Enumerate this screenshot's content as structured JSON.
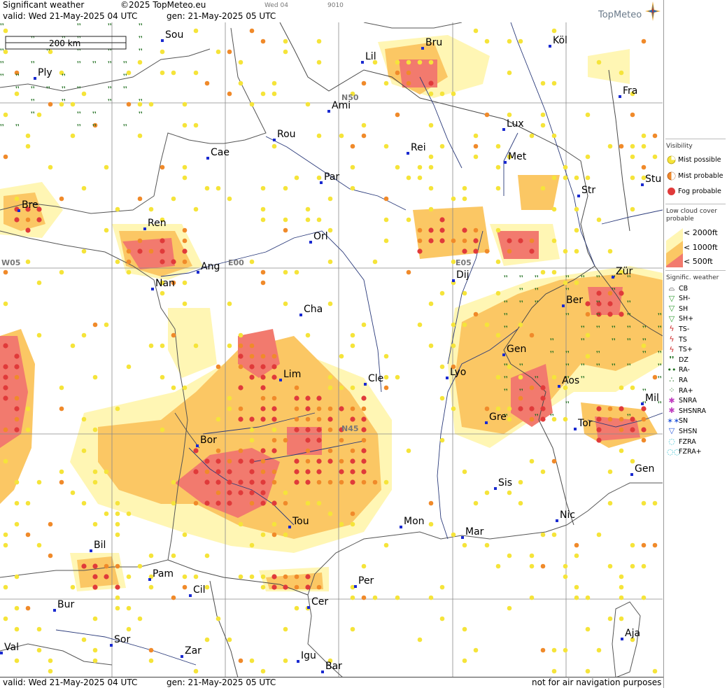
{
  "header": {
    "title": "Significant weather",
    "copyright": "©2025 TopMeteo.eu",
    "valid_line": "valid:  Wed  21-May-2025  04 UTC",
    "gen_line": "gen: 21-May-2025 05 UTC",
    "small_label_1": "Wed 04",
    "small_label_2": "9010",
    "logo_text": "TopMeteo"
  },
  "footer": {
    "valid_line": "valid:  Wed  21-May-2025  04 UTC",
    "gen_line": "gen: 21-May-2025 05 UTC",
    "disclaimer": "not for air navigation purposes"
  },
  "scale_label": "200 km",
  "grid_labels": {
    "n50": "N50",
    "n45": "N45",
    "w05": "W05",
    "e00": "E00",
    "e05": "E05"
  },
  "cities": [
    {
      "name": "Sou"
    },
    {
      "name": "Köl"
    },
    {
      "name": "Ply"
    },
    {
      "name": "Lil"
    },
    {
      "name": "Bru"
    },
    {
      "name": "Ami"
    },
    {
      "name": "Fra"
    },
    {
      "name": "Rou"
    },
    {
      "name": "Lux"
    },
    {
      "name": "Cae"
    },
    {
      "name": "Rei"
    },
    {
      "name": "Met"
    },
    {
      "name": "Par"
    },
    {
      "name": "Stu"
    },
    {
      "name": "Bre"
    },
    {
      "name": "Str"
    },
    {
      "name": "Ren"
    },
    {
      "name": "Orl"
    },
    {
      "name": "Ang"
    },
    {
      "name": "Dij"
    },
    {
      "name": "Zür"
    },
    {
      "name": "Nan"
    },
    {
      "name": "Ber"
    },
    {
      "name": "Cha"
    },
    {
      "name": "Gen"
    },
    {
      "name": "Lim"
    },
    {
      "name": "Cle"
    },
    {
      "name": "Lyo"
    },
    {
      "name": "Aos"
    },
    {
      "name": "Mil"
    },
    {
      "name": "Gre"
    },
    {
      "name": "Tor"
    },
    {
      "name": "Bor"
    },
    {
      "name": "Gen"
    },
    {
      "name": "Sis"
    },
    {
      "name": "Nic"
    },
    {
      "name": "Tou"
    },
    {
      "name": "Mon"
    },
    {
      "name": "Mar"
    },
    {
      "name": "Bil"
    },
    {
      "name": "Pam"
    },
    {
      "name": "Per"
    },
    {
      "name": "Cil"
    },
    {
      "name": "Bur"
    },
    {
      "name": "Cer"
    },
    {
      "name": "Sor"
    },
    {
      "name": "Val"
    },
    {
      "name": "Zar"
    },
    {
      "name": "Igu"
    },
    {
      "name": "Aja"
    },
    {
      "name": "Bar"
    }
  ],
  "legend": {
    "visibility_title": "Visibility",
    "mist_possible": "Mist possible",
    "mist_probable": "Mist probable",
    "fog_probable": "Fog probable",
    "lowcloud_title": "Low cloud cover probable",
    "lc_2000": "< 2000ft",
    "lc_1000": "< 1000ft",
    "lc_500": "<   500ft",
    "sigwx_title": "Signific. weather",
    "items": [
      {
        "label": "CB",
        "icon": "cb-icon",
        "glyph": "⌓",
        "color": "#333333"
      },
      {
        "label": "SH-",
        "icon": "shower-light-icon",
        "glyph": "▽",
        "color": "#2e9a2e"
      },
      {
        "label": "SH",
        "icon": "shower-icon",
        "glyph": "▽",
        "color": "#2e9a2e"
      },
      {
        "label": "SH+",
        "icon": "shower-heavy-icon",
        "glyph": "▽",
        "color": "#2e9a2e"
      },
      {
        "label": "TS-",
        "icon": "thunderstorm-light-icon",
        "glyph": "ϟ",
        "color": "#cc2a2a"
      },
      {
        "label": "TS",
        "icon": "thunderstorm-icon",
        "glyph": "ϟ",
        "color": "#cc2a2a"
      },
      {
        "label": "TS+",
        "icon": "thunderstorm-heavy-icon",
        "glyph": "ϟ",
        "color": "#cc2a2a"
      },
      {
        "label": "DZ",
        "icon": "drizzle-icon",
        "glyph": "❜❜",
        "color": "#1e6e1e"
      },
      {
        "label": "RA-",
        "icon": "rain-light-icon",
        "glyph": "••",
        "color": "#1e6e1e"
      },
      {
        "label": "RA",
        "icon": "rain-icon",
        "glyph": "∴",
        "color": "#1e6e1e"
      },
      {
        "label": "RA+",
        "icon": "rain-heavy-icon",
        "glyph": "⁘",
        "color": "#1e6e1e"
      },
      {
        "label": "SNRA",
        "icon": "snow-rain-icon",
        "glyph": "✱",
        "color": "#c040c0"
      },
      {
        "label": "SHSNRA",
        "icon": "shower-snow-rain-icon",
        "glyph": "✱",
        "color": "#c040c0"
      },
      {
        "label": "SN",
        "icon": "snow-icon",
        "glyph": "✶✶",
        "color": "#2a5adc"
      },
      {
        "label": "SHSN",
        "icon": "shower-snow-icon",
        "glyph": "▽",
        "color": "#2a5adc"
      },
      {
        "label": "FZRA",
        "icon": "freezing-rain-icon",
        "glyph": "◌",
        "color": "#20b8c8"
      },
      {
        "label": "FZRA+",
        "icon": "freezing-rain-heavy-icon",
        "glyph": "◌◌",
        "color": "#20b8c8"
      }
    ]
  },
  "colors": {
    "lc_2000": "#fff6b4",
    "lc_1000": "#fbc764",
    "lc_500": "#f27a6e",
    "fog": "#e03a3a",
    "mist_probable": "#f08a2a",
    "mist_possible": "#f5e43a",
    "coast": "#555555",
    "border": "#4a4a4a",
    "river": "#2a3a7a",
    "grid": "#8a8a8a"
  }
}
